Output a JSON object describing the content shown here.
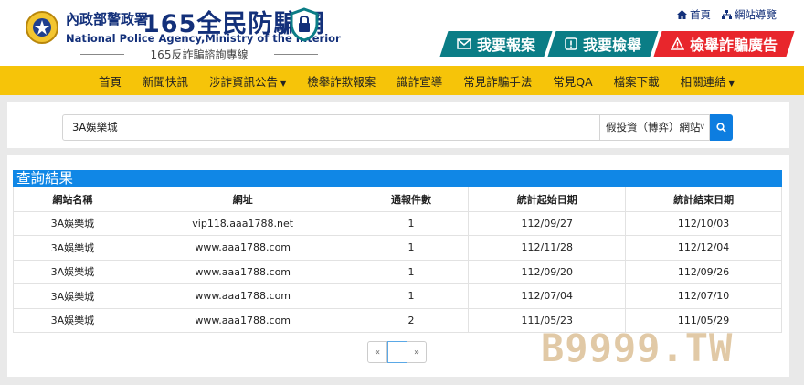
{
  "header": {
    "agency_zh": "內政部警政署",
    "site_name": "165全民防騙網",
    "agency_en": "National Police Agency,Ministry of the Interior",
    "hotline": "165反詐騙諮詢專線",
    "top_links": [
      "首頁",
      "網站導覽"
    ],
    "actions": [
      {
        "label": "我要報案",
        "icon": "envelope-icon",
        "color": "#0b7d86"
      },
      {
        "label": "我要檢舉",
        "icon": "exclamation-box-icon",
        "color": "#0b7d86"
      },
      {
        "label": "檢舉詐騙廣告",
        "icon": "warning-triangle-icon",
        "color": "#e8262c"
      }
    ]
  },
  "nav": {
    "items": [
      {
        "label": "首頁",
        "dropdown": false
      },
      {
        "label": "新聞快訊",
        "dropdown": false
      },
      {
        "label": "涉詐資訊公告",
        "dropdown": true
      },
      {
        "label": "檢舉詐欺報案",
        "dropdown": false
      },
      {
        "label": "識詐宣導",
        "dropdown": false
      },
      {
        "label": "常見詐騙手法",
        "dropdown": false
      },
      {
        "label": "常見QA",
        "dropdown": false
      },
      {
        "label": "檔案下載",
        "dropdown": false
      },
      {
        "label": "相關連結",
        "dropdown": true
      }
    ]
  },
  "search": {
    "value": "3A娛樂城",
    "category": "假投資（博弈）網站"
  },
  "results": {
    "title": "查詢結果",
    "columns": [
      "網站名稱",
      "網址",
      "通報件數",
      "統計起始日期",
      "統計結束日期"
    ],
    "rows": [
      [
        "3A娛樂城",
        "vip118.aaa1788.net",
        "1",
        "112/09/27",
        "112/10/03"
      ],
      [
        "3A娛樂城",
        "www.aaa1788.com",
        "1",
        "112/11/28",
        "112/12/04"
      ],
      [
        "3A娛樂城",
        "www.aaa1788.com",
        "1",
        "112/09/20",
        "112/09/26"
      ],
      [
        "3A娛樂城",
        "www.aaa1788.com",
        "1",
        "112/07/04",
        "112/07/10"
      ],
      [
        "3A娛樂城",
        "www.aaa1788.com",
        "2",
        "111/05/23",
        "111/05/29"
      ]
    ]
  },
  "pagination": {
    "prev": "«",
    "current": "",
    "next": "»"
  },
  "watermark": "B9999.TW",
  "colors": {
    "nav": "#f6c409",
    "brand": "#13307a",
    "title_bar": "#1087e6",
    "search_btn": "#0d7de0"
  }
}
